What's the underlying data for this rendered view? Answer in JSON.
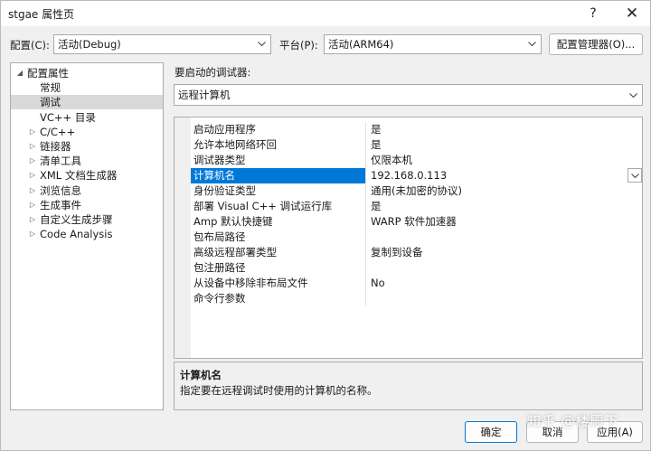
{
  "window": {
    "title": "stgae 属性页"
  },
  "titlebar": {
    "help_icon": "?",
    "close_icon": "✕"
  },
  "config": {
    "config_label": "配置(C):",
    "config_value": "活动(Debug)",
    "platform_label": "平台(P):",
    "platform_value": "活动(ARM64)",
    "manager_button": "配置管理器(O)..."
  },
  "tree": {
    "items": [
      {
        "label": "配置属性",
        "expander": "◢"
      },
      {
        "label": "常规"
      },
      {
        "label": "调试"
      },
      {
        "label": "VC++ 目录"
      },
      {
        "label": "C/C++",
        "expander": "▷"
      },
      {
        "label": "链接器",
        "expander": "▷"
      },
      {
        "label": "清单工具",
        "expander": "▷"
      },
      {
        "label": "XML 文档生成器",
        "expander": "▷"
      },
      {
        "label": "浏览信息",
        "expander": "▷"
      },
      {
        "label": "生成事件",
        "expander": "▷"
      },
      {
        "label": "自定义生成步骤",
        "expander": "▷"
      },
      {
        "label": "Code Analysis",
        "expander": "▷"
      }
    ]
  },
  "debugger": {
    "label": "要启动的调试器:",
    "value": "远程计算机"
  },
  "grid": {
    "rows": [
      {
        "name": "启动应用程序",
        "value": "是"
      },
      {
        "name": "允许本地网络环回",
        "value": "是"
      },
      {
        "name": "调试器类型",
        "value": "仅限本机"
      },
      {
        "name": "计算机名",
        "value": "192.168.0.113"
      },
      {
        "name": "身份验证类型",
        "value": "通用(未加密的协议)"
      },
      {
        "name": "部署 Visual C++ 调试运行库",
        "value": "是"
      },
      {
        "name": "Amp 默认快捷键",
        "value": "WARP 软件加速器"
      },
      {
        "name": "包布局路径",
        "value": ""
      },
      {
        "name": "高级远程部署类型",
        "value": "复制到设备"
      },
      {
        "name": "包注册路径",
        "value": ""
      },
      {
        "name": "从设备中移除非布局文件",
        "value": "No"
      },
      {
        "name": "命令行参数",
        "value": ""
      }
    ]
  },
  "description": {
    "title": "计算机名",
    "text": "指定要在远程调试时使用的计算机的名称。"
  },
  "buttons": {
    "ok": "确定",
    "cancel": "取消",
    "apply": "应用(A)"
  },
  "watermark": "知乎 @楼殿下"
}
